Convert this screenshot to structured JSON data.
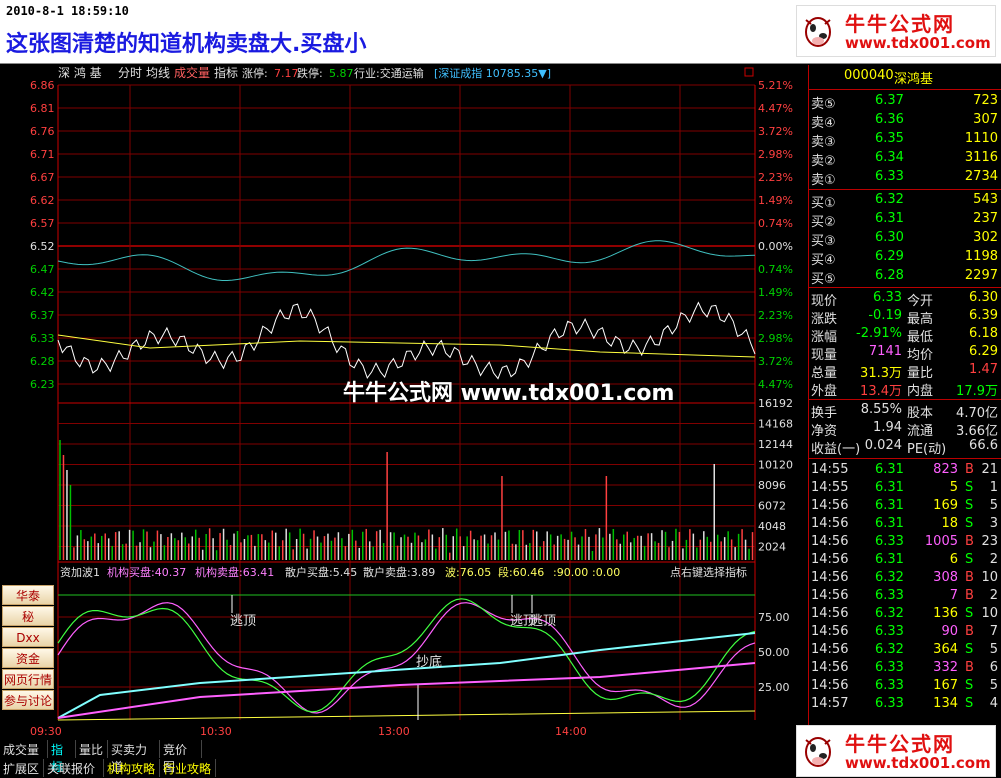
{
  "header": {
    "datetime": "2010-8-1 18:59:10",
    "headline": "这张图清楚的知道机构卖盘大.买盘小"
  },
  "logo": {
    "title": "牛牛公式网",
    "url": "www.tdx001.com"
  },
  "watermark": "牛牛公式网 www.tdx001.com",
  "chart_header": {
    "name": "深 鸿 基",
    "tabs": [
      "分时",
      "均线",
      "成交量",
      "指标"
    ],
    "limit_up_label": "涨停:",
    "limit_up": "7.17",
    "limit_down_label": "跌停:",
    "limit_down": "5.87",
    "industry": "行业:交通运输",
    "index": "[深证成指 10785.35▼]"
  },
  "price_axis": [
    "6.86",
    "6.81",
    "6.76",
    "6.71",
    "6.67",
    "6.62",
    "6.57",
    "6.52",
    "6.47",
    "6.42",
    "6.37",
    "6.33",
    "6.28",
    "6.23"
  ],
  "pct_axis": [
    "5.21%",
    "4.47%",
    "3.72%",
    "2.98%",
    "2.23%",
    "1.49%",
    "0.74%",
    "0.00%",
    "0.74%",
    "1.49%",
    "2.23%",
    "2.98%",
    "3.72%",
    "4.47%"
  ],
  "vol_axis": [
    "16192",
    "14168",
    "12144",
    "10120",
    "8096",
    "6072",
    "4048",
    "2024"
  ],
  "ind_axis": [
    "75.00",
    "50.00",
    "25.00"
  ],
  "time_axis": [
    "09:30",
    "10:30",
    "13:00",
    "14:00"
  ],
  "indicator_header": {
    "name": "资加波1",
    "items": [
      "机构买盘:40.37",
      "机构卖盘:63.41",
      "散户买盘:5.45",
      "散户卖盘:3.89",
      "波:76.05",
      "段:60.46",
      ":90.00",
      ":0.00"
    ],
    "hint": "点右键选择指标"
  },
  "annotations": [
    "逃顶",
    "抄底",
    "逃顶",
    "逃顶"
  ],
  "side_buttons": [
    "华泰",
    "秘",
    "Dxx",
    "资金",
    "网页行情",
    "参与讨论"
  ],
  "colors": {
    "up": "#ff4040",
    "down": "#00d000",
    "text": "#c0c0c0",
    "grid": "#800000",
    "accent": "#ffff00"
  },
  "quote": {
    "code": "000040",
    "name": "深鸿基",
    "asks": [
      {
        "label": "卖⑤",
        "price": "6.37",
        "vol": "723"
      },
      {
        "label": "卖④",
        "price": "6.36",
        "vol": "307"
      },
      {
        "label": "卖③",
        "price": "6.35",
        "vol": "1110"
      },
      {
        "label": "卖②",
        "price": "6.34",
        "vol": "3116"
      },
      {
        "label": "卖①",
        "price": "6.33",
        "vol": "2734"
      }
    ],
    "bids": [
      {
        "label": "买①",
        "price": "6.32",
        "vol": "543"
      },
      {
        "label": "买②",
        "price": "6.31",
        "vol": "237"
      },
      {
        "label": "买③",
        "price": "6.30",
        "vol": "302"
      },
      {
        "label": "买④",
        "price": "6.29",
        "vol": "1198"
      },
      {
        "label": "买⑤",
        "price": "6.28",
        "vol": "2297"
      }
    ],
    "stats": [
      {
        "l1": "现价",
        "v1": "6.33",
        "l2": "今开",
        "v2": "6.30"
      },
      {
        "l1": "涨跌",
        "v1": "-0.19",
        "l2": "最高",
        "v2": "6.39"
      },
      {
        "l1": "涨幅",
        "v1": "-2.91%",
        "l2": "最低",
        "v2": "6.18"
      },
      {
        "l1": "现量",
        "v1": "7141",
        "l2": "均价",
        "v2": "6.29"
      },
      {
        "l1": "总量",
        "v1": "31.3万",
        "l2": "量比",
        "v2": "1.47"
      },
      {
        "l1": "外盘",
        "v1": "13.4万",
        "l2": "内盘",
        "v2": "17.9万"
      }
    ],
    "stats2": [
      {
        "l1": "换手",
        "v1": "8.55%",
        "l2": "股本",
        "v2": "4.70亿"
      },
      {
        "l1": "净资",
        "v1": "1.94",
        "l2": "流通",
        "v2": "3.66亿"
      },
      {
        "l1": "收益(一)",
        "v1": "0.024",
        "l2": "PE(动)",
        "v2": "66.6"
      }
    ],
    "ticks": [
      {
        "t": "14:55",
        "p": "6.31",
        "v": "823",
        "bs": "B",
        "n": "21"
      },
      {
        "t": "14:55",
        "p": "6.31",
        "v": "5",
        "bs": "S",
        "n": "1"
      },
      {
        "t": "14:56",
        "p": "6.31",
        "v": "169",
        "bs": "S",
        "n": "5"
      },
      {
        "t": "14:56",
        "p": "6.31",
        "v": "18",
        "bs": "S",
        "n": "3"
      },
      {
        "t": "14:56",
        "p": "6.33",
        "v": "1005",
        "bs": "B",
        "n": "23"
      },
      {
        "t": "14:56",
        "p": "6.31",
        "v": "6",
        "bs": "S",
        "n": "2"
      },
      {
        "t": "14:56",
        "p": "6.32",
        "v": "308",
        "bs": "B",
        "n": "10"
      },
      {
        "t": "14:56",
        "p": "6.33",
        "v": "7",
        "bs": "B",
        "n": "2"
      },
      {
        "t": "14:56",
        "p": "6.32",
        "v": "136",
        "bs": "S",
        "n": "10"
      },
      {
        "t": "14:56",
        "p": "6.33",
        "v": "90",
        "bs": "B",
        "n": "7"
      },
      {
        "t": "14:56",
        "p": "6.32",
        "v": "364",
        "bs": "S",
        "n": "5"
      },
      {
        "t": "14:56",
        "p": "6.33",
        "v": "332",
        "bs": "B",
        "n": "6"
      },
      {
        "t": "14:56",
        "p": "6.33",
        "v": "167",
        "bs": "S",
        "n": "5"
      },
      {
        "t": "14:57",
        "p": "6.33",
        "v": "134",
        "bs": "S",
        "n": "4"
      }
    ]
  },
  "bottom_tabs_row1": [
    "成交量",
    "指标",
    "量比",
    "买卖力道",
    "竞价图"
  ],
  "bottom_tabs_row2": [
    "扩展区",
    "关联报价",
    "机构攻略",
    "行业攻略"
  ]
}
